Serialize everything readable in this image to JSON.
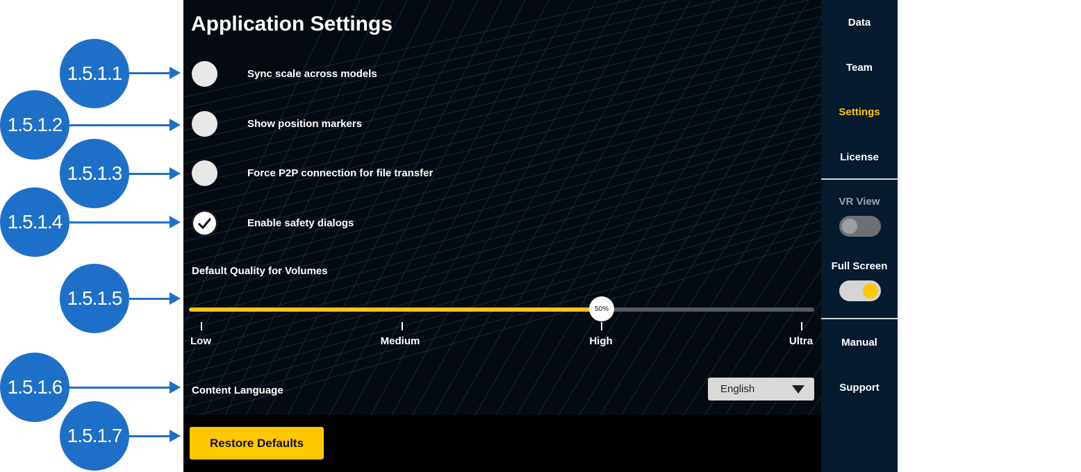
{
  "callouts": [
    "1.5.1.1",
    "1.5.1.2",
    "1.5.1.3",
    "1.5.1.4",
    "1.5.1.5",
    "1.5.1.6",
    "1.5.1.7"
  ],
  "settings": {
    "title": "Application Settings",
    "options": [
      {
        "label": "Sync scale across models",
        "checked": false
      },
      {
        "label": "Show position markers",
        "checked": false
      },
      {
        "label": "Force P2P connection for file transfer",
        "checked": false
      },
      {
        "label": "Enable safety dialogs",
        "checked": true
      }
    ],
    "quality": {
      "label": "Default Quality for Volumes",
      "value_label": "50%",
      "value_fraction": 0.66,
      "ticks": [
        "Low",
        "Medium",
        "High",
        "Ultra"
      ]
    },
    "language": {
      "label": "Content Language",
      "selected": "English"
    },
    "restore_label": "Restore Defaults"
  },
  "sidebar": {
    "items": [
      "Data",
      "Team",
      "Settings",
      "License"
    ],
    "active": "Settings",
    "vr_view": {
      "label": "VR View",
      "on": false
    },
    "full_screen": {
      "label": "Full Screen",
      "on": true
    },
    "bottom_items": [
      "Manual",
      "Support"
    ]
  },
  "colors": {
    "accent": "#ffc800",
    "callout": "#1e6fc8",
    "panel": "#050a10",
    "sidebar": "#051a2c"
  }
}
